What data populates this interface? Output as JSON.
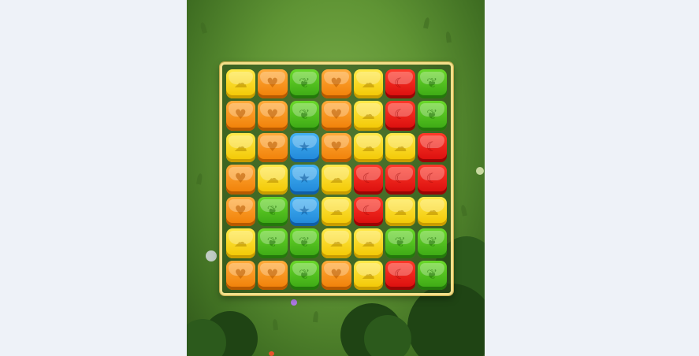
{
  "game": {
    "columns": 7,
    "rows": 7,
    "colors": {
      "yellow": "#f5cf0a",
      "orange": "#f5890f",
      "green": "#44b01a",
      "red": "#e0120f",
      "blue": "#2a93de"
    },
    "icons": {
      "yellow": "cloud-icon",
      "orange": "heart-icon",
      "green": "leaf-icon",
      "red": "moon-icon",
      "blue": "star-icon"
    },
    "grid": [
      [
        "yellow",
        "orange",
        "green",
        "orange",
        "yellow",
        "red",
        "green"
      ],
      [
        "orange",
        "orange",
        "green",
        "orange",
        "yellow",
        "red",
        "green"
      ],
      [
        "yellow",
        "orange",
        "blue",
        "orange",
        "yellow",
        "yellow",
        "red"
      ],
      [
        "orange",
        "yellow",
        "blue",
        "yellow",
        "red",
        "red",
        "red"
      ],
      [
        "orange",
        "green",
        "blue",
        "yellow",
        "red",
        "yellow",
        "yellow"
      ],
      [
        "yellow",
        "green",
        "green",
        "yellow",
        "yellow",
        "green",
        "green"
      ],
      [
        "orange",
        "orange",
        "green",
        "orange",
        "yellow",
        "red",
        "green"
      ]
    ]
  }
}
